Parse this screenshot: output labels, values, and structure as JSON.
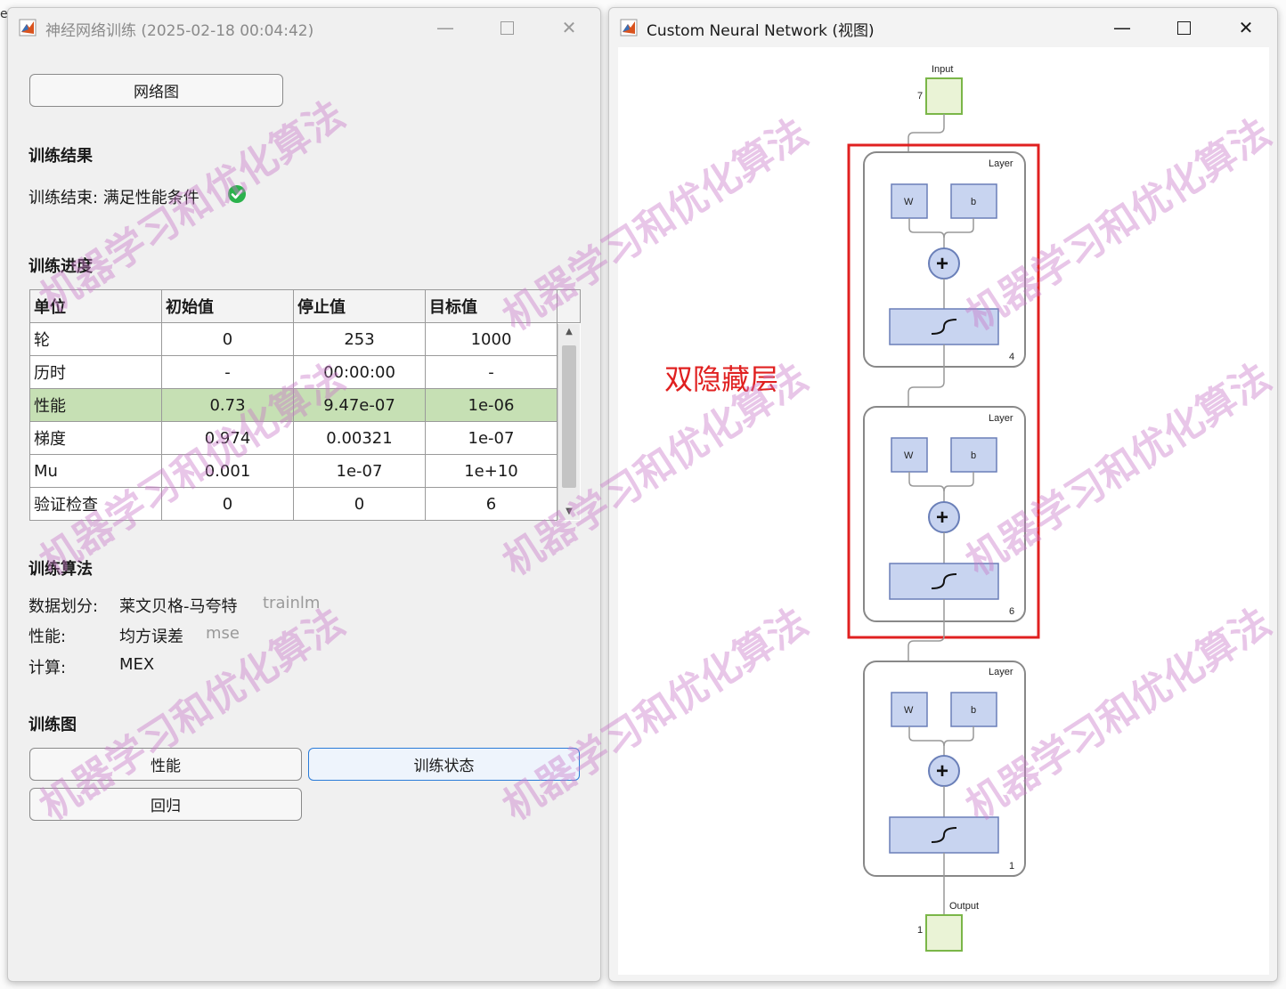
{
  "training_window": {
    "title": "神经网络训练 (2025-02-18 00:04:42)",
    "network_view_button": "网络图",
    "results": {
      "heading": "训练结果",
      "status_text": "训练结束: 满足性能条件"
    },
    "progress": {
      "heading": "训练进度",
      "columns": [
        "单位",
        "初始值",
        "停止值",
        "目标值"
      ],
      "rows": [
        {
          "unit": "轮",
          "initial": "0",
          "stop": "253",
          "target": "1000"
        },
        {
          "unit": "历时",
          "initial": "-",
          "stop": "00:00:00",
          "target": "-"
        },
        {
          "unit": "性能",
          "initial": "0.73",
          "stop": "9.47e-07",
          "target": "1e-06"
        },
        {
          "unit": "梯度",
          "initial": "0.974",
          "stop": "0.00321",
          "target": "1e-07"
        },
        {
          "unit": "Mu",
          "initial": "0.001",
          "stop": "1e-07",
          "target": "1e+10"
        },
        {
          "unit": "验证检查",
          "initial": "0",
          "stop": "0",
          "target": "6"
        }
      ],
      "highlighted_row": 2
    },
    "algorithms": {
      "heading": "训练算法",
      "items": [
        {
          "label": "数据划分:",
          "value": "莱文贝格-马夸特",
          "code": "trainlm"
        },
        {
          "label": "性能:",
          "value": "均方误差",
          "code": "mse"
        },
        {
          "label": "计算:",
          "value": "MEX",
          "code": ""
        }
      ]
    },
    "plots": {
      "heading": "训练图",
      "performance_button": "性能",
      "training_state_button": "训练状态",
      "regression_button": "回归"
    }
  },
  "network_window": {
    "title": "Custom Neural Network (视图)",
    "annotation": "双隐藏层",
    "input": {
      "label": "Input",
      "size": "7"
    },
    "layers": [
      {
        "label": "Layer",
        "w": "W",
        "b": "b",
        "size": "4"
      },
      {
        "label": "Layer",
        "w": "W",
        "b": "b",
        "size": "6"
      },
      {
        "label": "Layer",
        "w": "W",
        "b": "b",
        "size": "1"
      }
    ],
    "output": {
      "label": "Output",
      "size": "1"
    }
  },
  "watermark": "机器学习和优化算法",
  "colors": {
    "success_icon": "#2bb24c",
    "highlight_row": "#c6e0b4",
    "annotation_red": "#e02020",
    "block_fill": "#c8d4f0",
    "io_fill": "#eaf3d6",
    "io_border": "#7ab648"
  }
}
